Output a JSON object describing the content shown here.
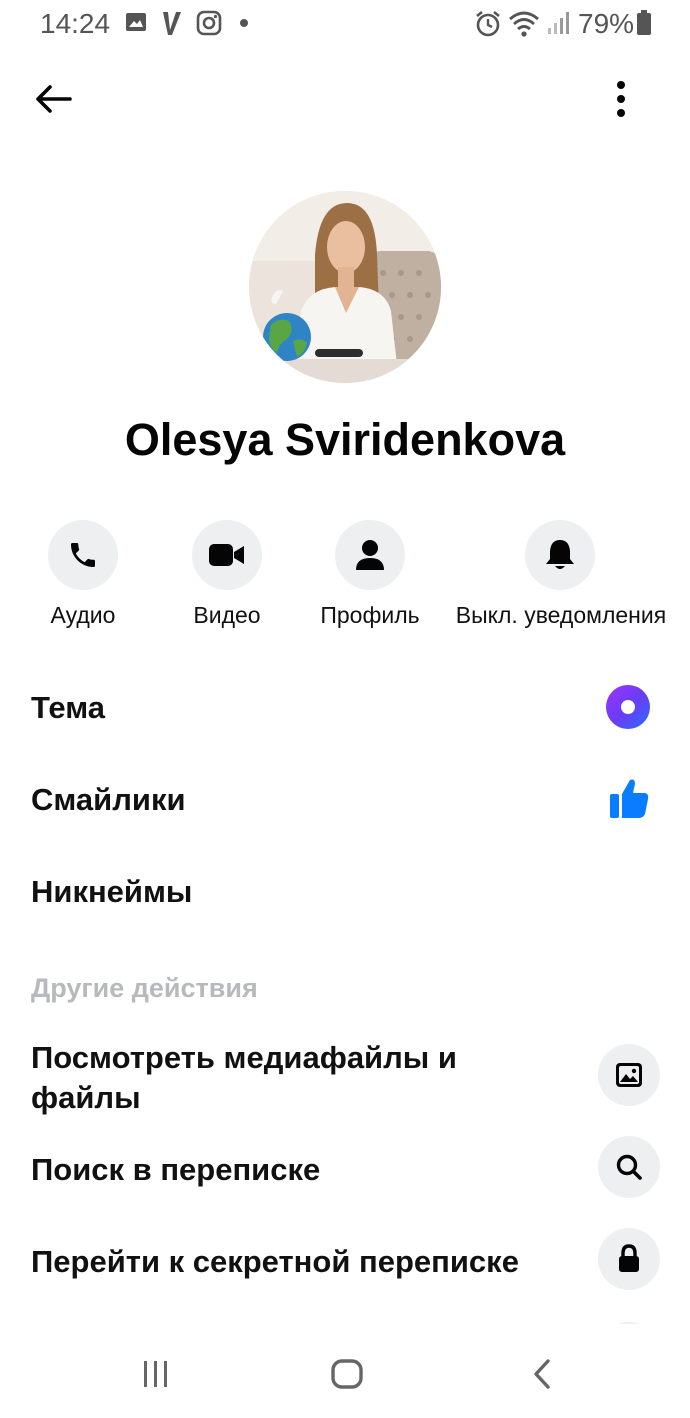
{
  "status_bar": {
    "time": "14:24",
    "battery": "79%",
    "icons": [
      "gallery-icon",
      "v-app-icon",
      "instagram-icon",
      "dot-icon",
      "alarm-icon",
      "wifi-icon",
      "signal-icon",
      "battery-icon"
    ]
  },
  "header": {
    "back_icon": "arrow-left-icon",
    "menu_icon": "more-vertical-icon"
  },
  "profile": {
    "name": "Olesya Sviridenkova"
  },
  "actions": [
    {
      "label": "Аудио",
      "icon": "phone-icon"
    },
    {
      "label": "Видео",
      "icon": "video-camera-icon"
    },
    {
      "label": "Профиль",
      "icon": "person-icon"
    },
    {
      "label": "Выкл. уведомления",
      "icon": "bell-icon"
    }
  ],
  "settings": {
    "theme_label": "Тема",
    "emoji_label": "Смайлики",
    "nicknames_label": "Никнеймы",
    "theme_color": "#6a3cf5",
    "emoji_color": "#0a7cff"
  },
  "more_actions": {
    "header": "Другие действия",
    "items": [
      {
        "label": "Посмотреть медиафайлы и файлы",
        "icon": "image-icon"
      },
      {
        "label": "Поиск в переписке",
        "icon": "search-icon"
      },
      {
        "label": "Перейти к секретной переписке",
        "icon": "lock-icon"
      }
    ]
  },
  "nav_bar": {
    "icons": [
      "recent-apps-icon",
      "home-icon",
      "back-icon"
    ]
  }
}
